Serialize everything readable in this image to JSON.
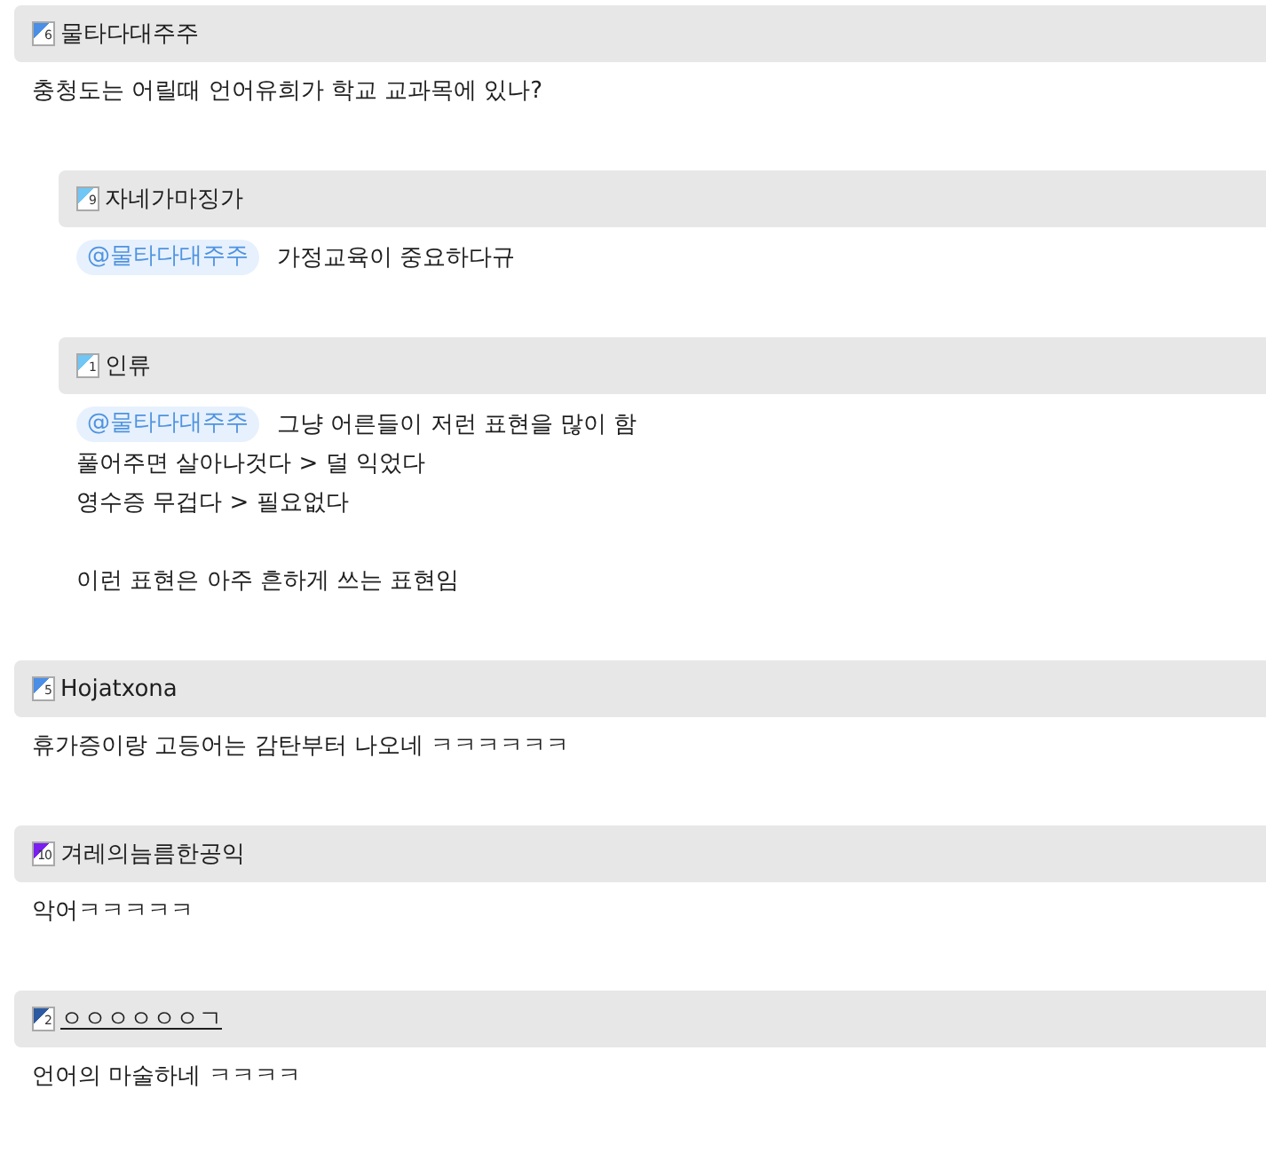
{
  "comments": [
    {
      "author": "물타다대주주",
      "badge": "6",
      "color": "#4a8ee6",
      "underlined": false,
      "paragraphs": [
        [
          "충청도는 어릴때 언어유희가 학교 교과목에 있나?"
        ]
      ],
      "replies": [
        {
          "author": "자네가마징가",
          "badge": "9",
          "color": "#70c6f5",
          "underlined": false,
          "mention": "@물타다대주주",
          "paragraphs": [
            [
              "가정교육이 중요하다규"
            ]
          ]
        },
        {
          "author": "인류",
          "badge": "1",
          "color": "#70c6f5",
          "underlined": false,
          "mention": "@물타다대주주",
          "paragraphs": [
            [
              "그냥 어른들이 저런 표현을 많이 함",
              "풀어주면 살아나것다 > 덜 익었다",
              "영수증 무겁다 > 필요없다"
            ],
            [
              "이런 표현은 아주 흔하게 쓰는 표현임"
            ]
          ]
        }
      ]
    },
    {
      "author": "Hojatxona",
      "badge": "5",
      "color": "#4a8ee6",
      "underlined": false,
      "paragraphs": [
        [
          "휴가증이랑 고등어는 감탄부터 나오네 ㅋㅋㅋㅋㅋㅋ"
        ]
      ]
    },
    {
      "author": "겨레의늠름한공익",
      "badge": "10",
      "color": "#7a1ef0",
      "underlined": false,
      "paragraphs": [
        [
          "악어ㅋㅋㅋㅋㅋ"
        ]
      ]
    },
    {
      "author": "ㅇㅇㅇㅇㅇㅇㄱ",
      "badge": "2",
      "color": "#2c5aa0",
      "underlined": true,
      "paragraphs": [
        [
          "언어의 마술하네 ㅋㅋㅋㅋ"
        ]
      ]
    }
  ]
}
